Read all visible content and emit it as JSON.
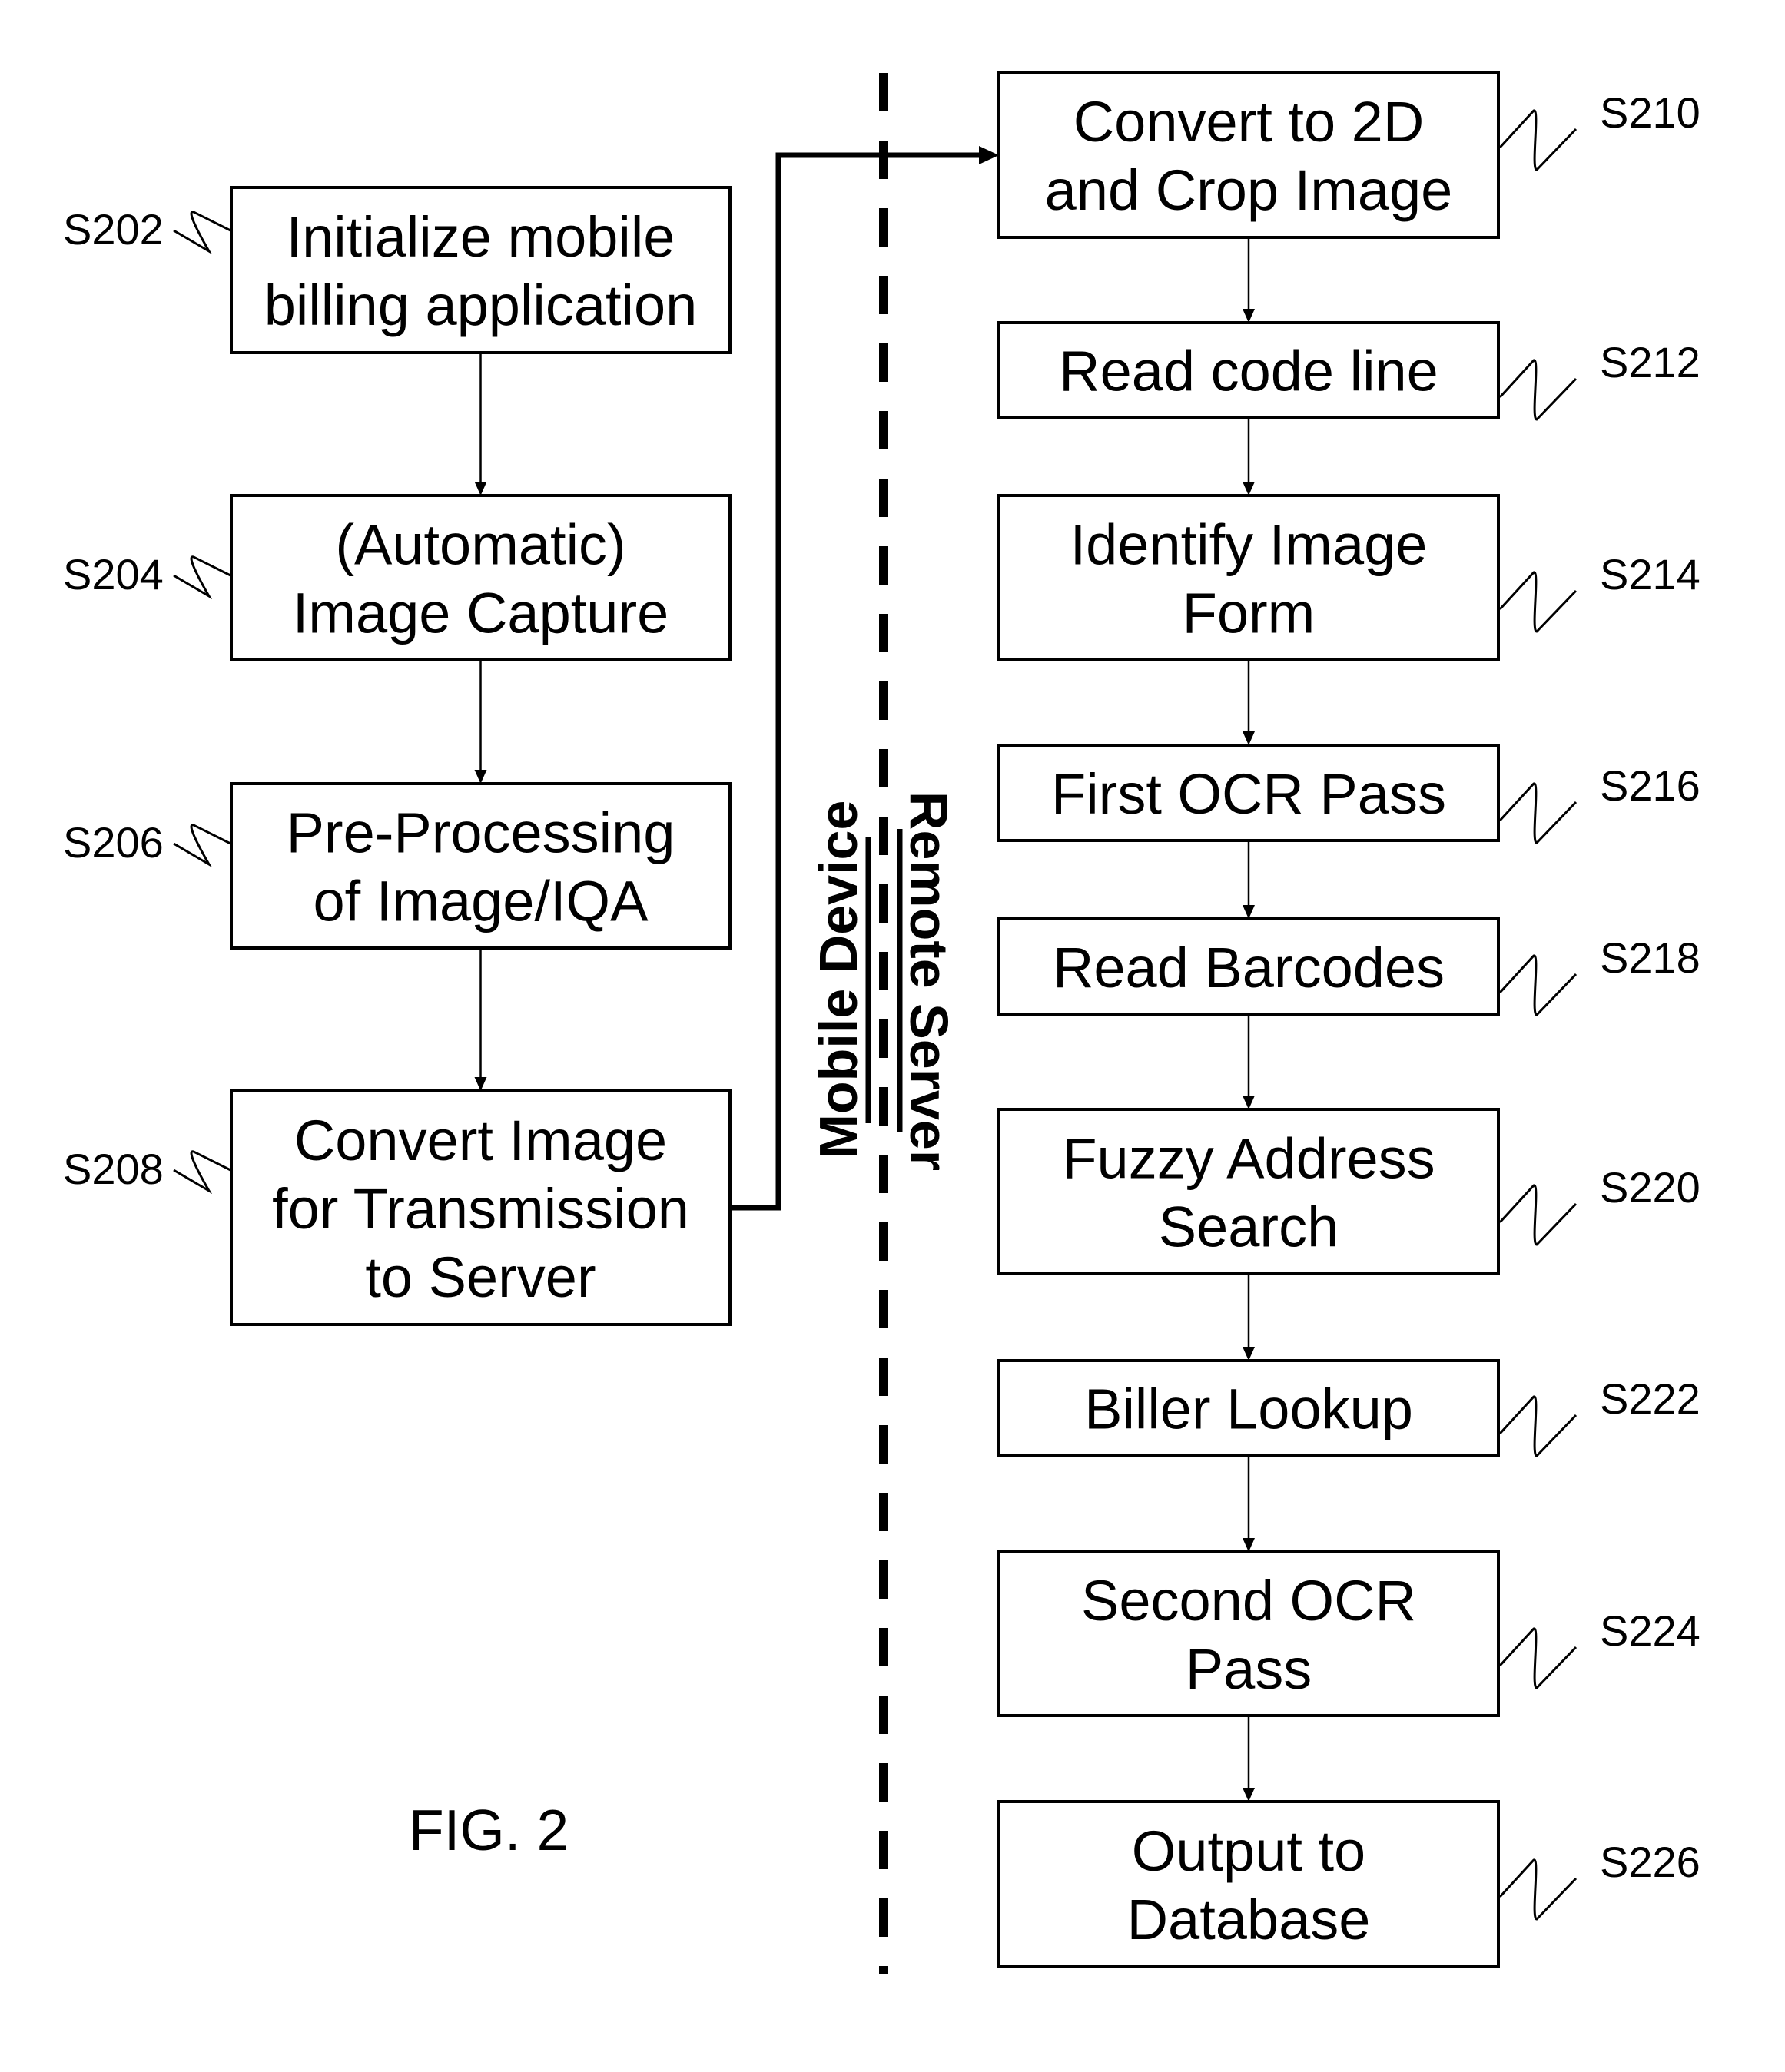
{
  "figure_label": "FIG. 2",
  "lanes": {
    "left": "Mobile Device",
    "right": "Remote Server"
  },
  "mobile_steps": [
    {
      "id": "S202",
      "lines": [
        "Initialize mobile",
        "billing application"
      ]
    },
    {
      "id": "S204",
      "lines": [
        "(Automatic)",
        "Image Capture"
      ]
    },
    {
      "id": "S206",
      "lines": [
        "Pre-Processing",
        "of Image/IQA"
      ]
    },
    {
      "id": "S208",
      "lines": [
        "Convert Image",
        "for Transmission",
        "to Server"
      ]
    }
  ],
  "server_steps": [
    {
      "id": "S210",
      "lines": [
        "Convert to 2D",
        "and Crop Image"
      ]
    },
    {
      "id": "S212",
      "lines": [
        "Read code line"
      ]
    },
    {
      "id": "S214",
      "lines": [
        "Identify Image",
        "Form"
      ]
    },
    {
      "id": "S216",
      "lines": [
        "First OCR Pass"
      ]
    },
    {
      "id": "S218",
      "lines": [
        "Read Barcodes"
      ]
    },
    {
      "id": "S220",
      "lines": [
        "Fuzzy Address",
        "Search"
      ]
    },
    {
      "id": "S222",
      "lines": [
        "Biller Lookup"
      ]
    },
    {
      "id": "S224",
      "lines": [
        "Second OCR",
        "Pass"
      ]
    },
    {
      "id": "S226",
      "lines": [
        "Output to",
        "Database"
      ]
    }
  ]
}
